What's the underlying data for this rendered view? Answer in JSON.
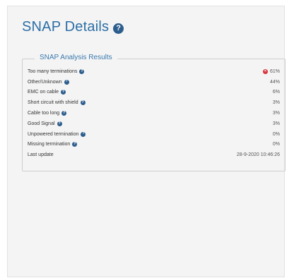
{
  "page": {
    "title": "SNAP Details",
    "help_icon": "question-circle-icon"
  },
  "results": {
    "legend": "SNAP Analysis Results",
    "rows": [
      {
        "label": "Too many terminations",
        "value": "61%",
        "help": true,
        "status_icon": "error-icon"
      },
      {
        "label": "Other/Unknown",
        "value": "44%",
        "help": true
      },
      {
        "label": "EMC on cable",
        "value": "6%",
        "help": true
      },
      {
        "label": "Short circuit with shield",
        "value": "3%",
        "help": true
      },
      {
        "label": "Cable too long",
        "value": "3%",
        "help": true
      },
      {
        "label": "Good Signal",
        "value": "3%",
        "help": true
      },
      {
        "label": "Unpowered termination",
        "value": "0%",
        "help": true
      },
      {
        "label": "Missing termination",
        "value": "0%",
        "help": true
      },
      {
        "label": "Last update",
        "value": "28-9-2020 10:46:26",
        "help": false
      }
    ]
  },
  "colors": {
    "title": "#2c6ea6",
    "help_icon_bg": "#2c5d8c",
    "error_icon_bg": "#d9333a",
    "panel_bg": "#f4f4f4"
  }
}
